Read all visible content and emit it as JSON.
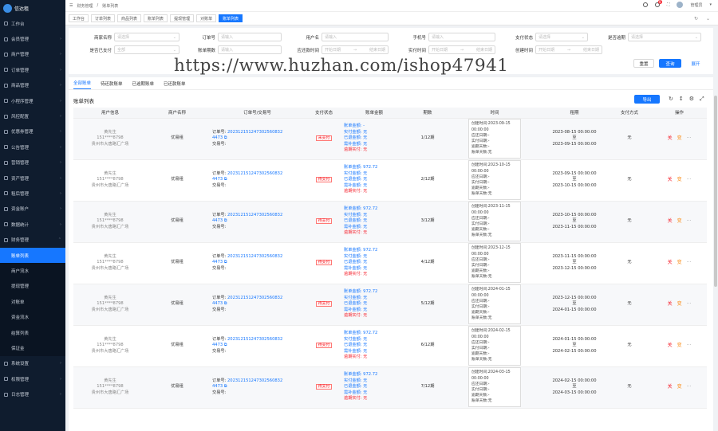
{
  "logo": {
    "text": "信达租"
  },
  "sidebar": {
    "items": [
      {
        "label": "工作台",
        "icon": "home-icon"
      },
      {
        "label": "会员管理",
        "icon": "user-icon"
      },
      {
        "label": "商户管理",
        "icon": "shop-icon"
      },
      {
        "label": "订单管理",
        "icon": "order-icon"
      },
      {
        "label": "商品管理",
        "icon": "goods-icon"
      },
      {
        "label": "小程序管理",
        "icon": "app-icon"
      },
      {
        "label": "风控配置",
        "icon": "shield-icon"
      },
      {
        "label": "优惠券管理",
        "icon": "coupon-icon"
      },
      {
        "label": "公告管理",
        "icon": "notice-icon"
      },
      {
        "label": "营销管理",
        "icon": "megaphone-icon"
      },
      {
        "label": "资产管理",
        "icon": "wallet-icon"
      },
      {
        "label": "租后管理",
        "icon": "clock-icon"
      },
      {
        "label": "资金账户",
        "icon": "account-icon"
      },
      {
        "label": "数据统计",
        "icon": "chart-icon"
      },
      {
        "label": "财务管理",
        "icon": "finance-icon"
      }
    ],
    "subitems": [
      {
        "label": "账单列表",
        "active": true
      },
      {
        "label": "商户流水"
      },
      {
        "label": "提现管理"
      },
      {
        "label": "对账单"
      },
      {
        "label": "资金流水"
      },
      {
        "label": "结算列表"
      },
      {
        "label": "保证金"
      }
    ],
    "tail": [
      {
        "label": "系统设置",
        "icon": "gear-icon"
      },
      {
        "label": "权限管理",
        "icon": "lock-icon"
      },
      {
        "label": "日志管理",
        "icon": "log-icon"
      }
    ]
  },
  "topbar": {
    "breadcrumb": [
      "财务管理",
      "账单列表"
    ],
    "badge": "8",
    "username": "管理员"
  },
  "pagetabs": [
    "工作台",
    "订单列表",
    "商品列表",
    "账单列表",
    "提现管理",
    "对账单",
    "账单列表"
  ],
  "filters": {
    "f1": {
      "label": "商家名称",
      "placeholder": "请选择"
    },
    "f2": {
      "label": "订单号",
      "placeholder": "请输入"
    },
    "f3": {
      "label": "用户名",
      "placeholder": "请输入"
    },
    "f4": {
      "label": "手机号",
      "placeholder": "请输入"
    },
    "f5": {
      "label": "支付状态",
      "placeholder": "请选择"
    },
    "f6": {
      "label": "是否逾期",
      "placeholder": "请选择"
    },
    "f7": {
      "label": "是否已支付",
      "placeholder": "全部"
    },
    "f8": {
      "label": "账单期数",
      "placeholder": "请输入"
    },
    "f9": {
      "label": "应还款时间",
      "start": "开始日期",
      "end": "结束日期"
    },
    "f10": {
      "label": "实付时间",
      "start": "开始日期",
      "end": "结束日期"
    },
    "f11": {
      "label": "创建时间",
      "start": "开始日期",
      "end": "结束日期"
    },
    "reset": "重置",
    "search": "查询",
    "expand": "展开"
  },
  "watermark": "https://www.huzhan.com/ishop47941",
  "subtabs": [
    "全部账单",
    "待还款账单",
    "已逾期账单",
    "已还款账单"
  ],
  "list": {
    "title": "账单列表",
    "export": "导出"
  },
  "table": {
    "headers": [
      "用户信息",
      "商户名称",
      "订单号/交易号",
      "支付状态",
      "账单金额",
      "期数",
      "时间",
      "租期",
      "支付方式",
      "操作"
    ],
    "rows": [
      {
        "user": [
          "黄先生",
          "151****8798",
          "贵州市大唐路汇广场"
        ],
        "merchant": "优易租",
        "order": "202312151247302560832",
        "order2": "4473",
        "trade": "交易号:",
        "status": "未支付",
        "m": [
          "账单金额: -",
          "实付金额: 无",
          "已退金额: 无",
          "需补金额: 无",
          "逾期实付: 无"
        ],
        "period": "1/12期",
        "time": [
          "创建时间:2023-09-15 00:00:00",
          "应还日期:-",
          "实付日期:-",
          "逾期天数:-",
          "账单天数:无"
        ],
        "term": [
          "2023-08-15 00:00:00",
          "至",
          "2023-09-15 00:00:00"
        ],
        "pay": "无"
      },
      {
        "user": [
          "黄先生",
          "151****8798",
          "贵州市大唐路汇广场"
        ],
        "merchant": "优易租",
        "order": "202312151247302560832",
        "order2": "4473",
        "trade": "交易号:",
        "status": "待支付",
        "m": [
          "账单金额: 972.72",
          "实付金额: 无",
          "已退金额: 无",
          "需补金额: 无",
          "逾期实付: 无"
        ],
        "period": "2/12期",
        "time": [
          "创建时间:2023-10-15 00:00:00",
          "应还日期:-",
          "实付日期:-",
          "逾期天数:-",
          "账单天数:无"
        ],
        "term": [
          "2023-09-15 00:00:00",
          "至",
          "2023-10-15 00:00:00"
        ],
        "pay": "无"
      },
      {
        "user": [
          "黄先生",
          "151****8798",
          "贵州市大唐路汇广场"
        ],
        "merchant": "优易租",
        "order": "202312151247302560832",
        "order2": "4473",
        "trade": "交易号:",
        "status": "待支付",
        "m": [
          "账单金额: 972.72",
          "实付金额: 无",
          "已退金额: 无",
          "需补金额: 无",
          "逾期实付: 无"
        ],
        "period": "3/12期",
        "time": [
          "创建时间:2023-11-15 00:00:00",
          "应还日期:-",
          "实付日期:-",
          "逾期天数:-",
          "账单天数:无"
        ],
        "term": [
          "2023-10-15 00:00:00",
          "至",
          "2023-11-15 00:00:00"
        ],
        "pay": "无"
      },
      {
        "user": [
          "黄先生",
          "151****8798",
          "贵州市大唐路汇广场"
        ],
        "merchant": "优易租",
        "order": "202312151247302560832",
        "order2": "4473",
        "trade": "交易号:",
        "status": "待支付",
        "m": [
          "账单金额: 972.72",
          "实付金额: 无",
          "已退金额: 无",
          "需补金额: 无",
          "逾期实付: 无"
        ],
        "period": "4/12期",
        "time": [
          "创建时间:2023-12-15 00:00:00",
          "应还日期:-",
          "实付日期:-",
          "逾期天数:-",
          "账单天数:无"
        ],
        "term": [
          "2023-11-15 00:00:00",
          "至",
          "2023-12-15 00:00:00"
        ],
        "pay": "无"
      },
      {
        "user": [
          "黄先生",
          "151****8798",
          "贵州市大唐路汇广场"
        ],
        "merchant": "优易租",
        "order": "202312151247302560832",
        "order2": "4473",
        "trade": "交易号:",
        "status": "待支付",
        "m": [
          "账单金额: 972.72",
          "实付金额: 无",
          "已退金额: 无",
          "需补金额: 无",
          "逾期实付: 无"
        ],
        "period": "5/12期",
        "time": [
          "创建时间:2024-01-15 00:00:00",
          "应还日期:-",
          "实付日期:-",
          "逾期天数:-",
          "账单天数:无"
        ],
        "term": [
          "2023-12-15 00:00:00",
          "至",
          "2024-01-15 00:00:00"
        ],
        "pay": "无"
      },
      {
        "user": [
          "黄先生",
          "151****8798",
          "贵州市大唐路汇广场"
        ],
        "merchant": "优易租",
        "order": "202312151247302560832",
        "order2": "4473",
        "trade": "交易号:",
        "status": "待支付",
        "m": [
          "账单金额: 972.72",
          "实付金额: 无",
          "已退金额: 无",
          "需补金额: 无",
          "逾期实付: 无"
        ],
        "period": "6/12期",
        "time": [
          "创建时间:2024-02-15 00:00:00",
          "应还日期:-",
          "实付日期:-",
          "逾期天数:-",
          "账单天数:无"
        ],
        "term": [
          "2024-01-15 00:00:00",
          "至",
          "2024-02-15 00:00:00"
        ],
        "pay": "无"
      },
      {
        "user": [
          "黄先生",
          "151****8798",
          "贵州市大唐路汇广场"
        ],
        "merchant": "优易租",
        "order": "202312151247302560832",
        "order2": "4473",
        "trade": "交易号:",
        "status": "待支付",
        "m": [
          "账单金额: 972.72",
          "实付金额: 无",
          "已退金额: 无",
          "需补金额: 无",
          "逾期实付: 无"
        ],
        "period": "7/12期",
        "time": [
          "创建时间:2024-03-15 00:00:00",
          "应还日期:-",
          "实付日期:-",
          "逾期天数:-",
          "账单天数:无"
        ],
        "term": [
          "2024-02-15 00:00:00",
          "至",
          "2024-03-15 00:00:00"
        ],
        "pay": "无"
      }
    ],
    "ops": [
      "关",
      "变",
      "···"
    ]
  }
}
